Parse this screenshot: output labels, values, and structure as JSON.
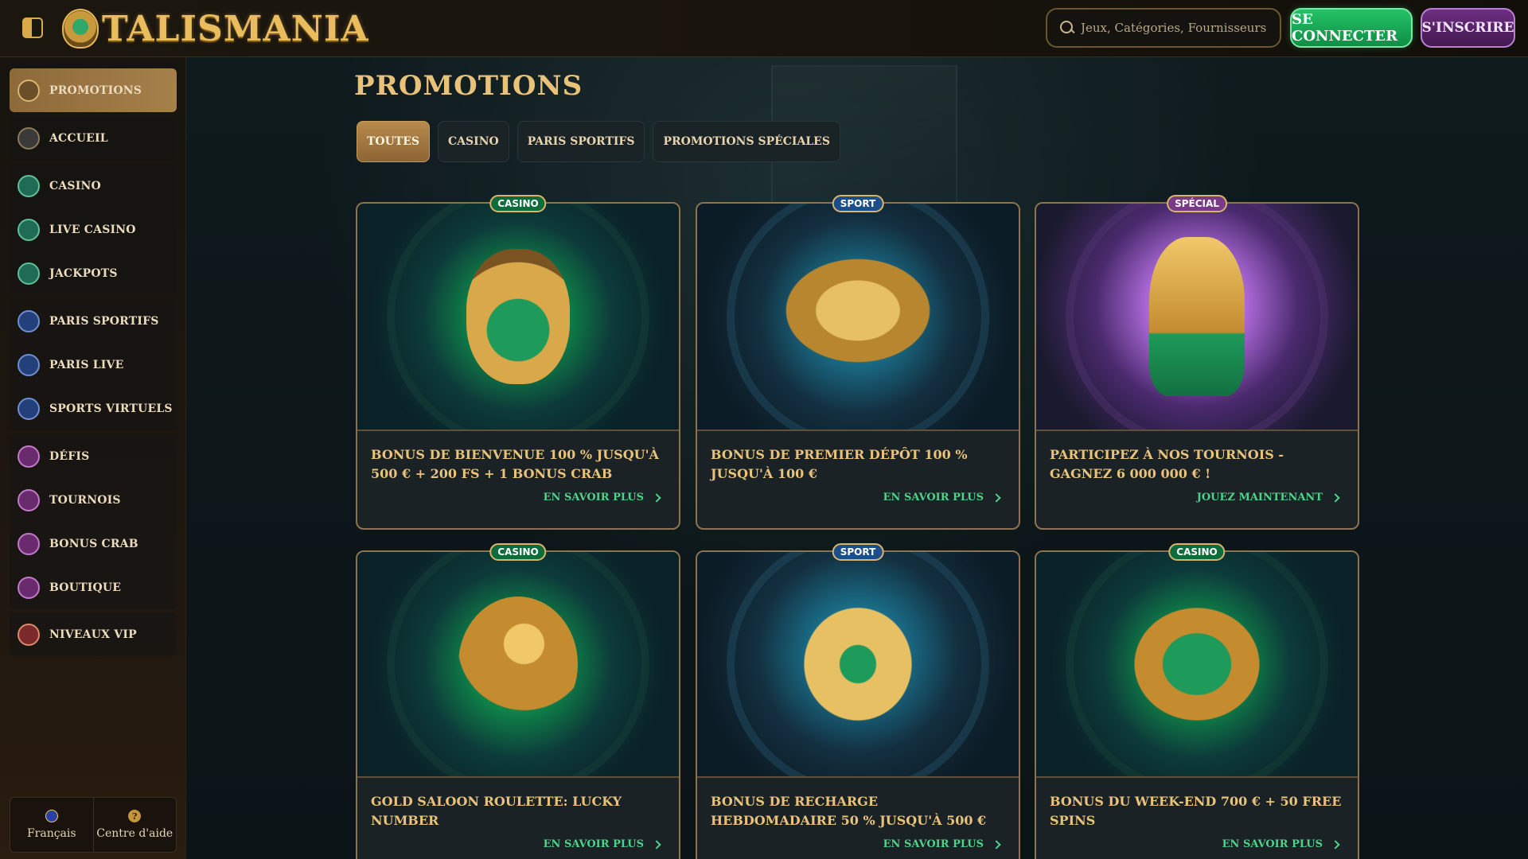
{
  "header": {
    "brand": "TALISMANIA",
    "search_placeholder": "Jeux, Catégories, Fournisseurs",
    "login_label": "SE CONNECTER",
    "signup_label": "S'INSCRIRE"
  },
  "sidebar": {
    "items": [
      {
        "label": "PROMOTIONS",
        "icon": "gift-icon"
      },
      {
        "label": "ACCUEIL",
        "icon": "home-icon"
      },
      {
        "label": "CASINO",
        "icon": "chip-icon"
      },
      {
        "label": "LIVE CASINO",
        "icon": "spade-icon"
      },
      {
        "label": "JACKPOTS",
        "icon": "clover-icon"
      },
      {
        "label": "PARIS SPORTIFS",
        "icon": "football-icon"
      },
      {
        "label": "PARIS LIVE",
        "icon": "play-icon"
      },
      {
        "label": "SPORTS VIRTUELS",
        "icon": "gamepad-icon"
      },
      {
        "label": "DÉFIS",
        "icon": "medal-icon"
      },
      {
        "label": "TOURNOIS",
        "icon": "trophy-icon"
      },
      {
        "label": "BONUS CRAB",
        "icon": "crab-icon"
      },
      {
        "label": "BOUTIQUE",
        "icon": "shop-icon"
      },
      {
        "label": "NIVEAUX VIP",
        "icon": "diamond-icon"
      }
    ],
    "footer": {
      "language": "Français",
      "help": "Centre d'aide",
      "help_glyph": "?"
    }
  },
  "main": {
    "title": "PROMOTIONS",
    "tabs": [
      {
        "label": "TOUTES",
        "active": true
      },
      {
        "label": "CASINO",
        "active": false
      },
      {
        "label": "PARIS SPORTIFS",
        "active": false
      },
      {
        "label": "PROMOTIONS SPÉCIALES",
        "active": false
      }
    ],
    "cards": [
      {
        "badge": "CASINO",
        "badge_type": "casino",
        "title": "BONUS DE BIENVENUE 100 % JUSQU'À 500 € + 200 FS + 1 BONUS CRAB",
        "cta": "EN SAVOIR PLUS",
        "art": "scarab"
      },
      {
        "badge": "SPORT",
        "badge_type": "sport",
        "title": "BONUS DE PREMIER DÉPÔT 100 % JUSQU'À 100 €",
        "cta": "EN SAVOIR PLUS",
        "art": "winged-ball"
      },
      {
        "badge": "SPÉCIAL",
        "badge_type": "special",
        "title": "PARTICIPEZ À NOS TOURNOIS - GAGNEZ 6 000 000 € !",
        "cta": "JOUEZ MAINTENANT",
        "art": "trophy"
      },
      {
        "badge": "CASINO",
        "badge_type": "casino",
        "title": "GOLD SALOON ROULETTE: LUCKY NUMBER",
        "cta": "EN SAVOIR PLUS",
        "art": "horus"
      },
      {
        "badge": "SPORT",
        "badge_type": "sport",
        "title": "BONUS DE RECHARGE HEBDOMADAIRE 50 % JUSQU'À 500 €",
        "cta": "EN SAVOIR PLUS",
        "art": "winged-cup"
      },
      {
        "badge": "CASINO",
        "badge_type": "casino",
        "title": "BONUS DU WEEK-END 700 € + 50 FREE SPINS",
        "cta": "EN SAVOIR PLUS",
        "art": "serpent"
      }
    ]
  },
  "colors": {
    "accent_gold": "#e9c27a",
    "cta_green": "#4fd38a",
    "login_green": "#25c267",
    "signup_purple": "#6d2f82"
  }
}
